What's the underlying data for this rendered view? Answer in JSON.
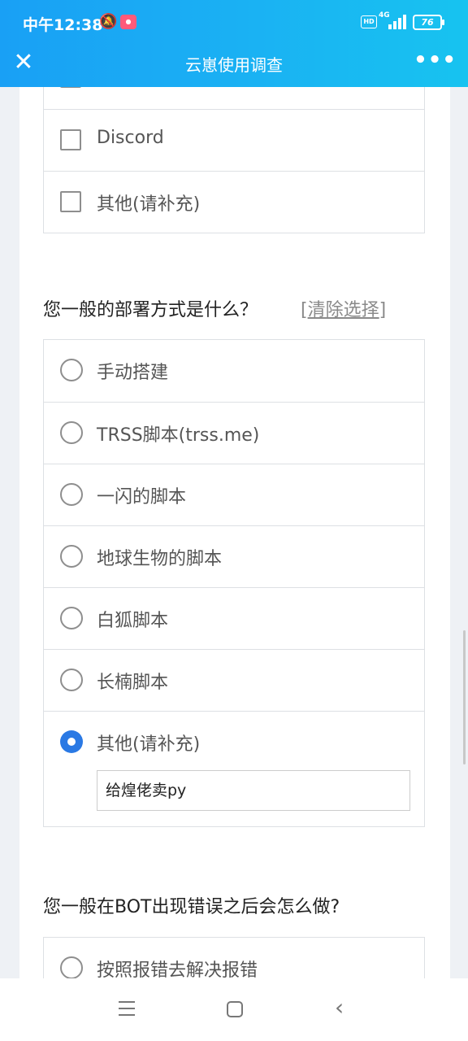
{
  "status_bar": {
    "time": "中午12:38",
    "network": "4G",
    "battery": "76",
    "hd": "HD"
  },
  "header": {
    "title": "云崽使用调查"
  },
  "q_prev": {
    "options": [
      "Discord",
      "其他(请补充)"
    ]
  },
  "q_deploy": {
    "title": "您一般的部署方式是什么？",
    "clear_label": "清除选择",
    "options": [
      "手动搭建",
      "TRSS脚本(trss.me)",
      "一闪的脚本",
      "地球生物的脚本",
      "白狐脚本",
      "长楠脚本",
      "其他(请补充)"
    ],
    "selected_index": 6,
    "other_value": "给煌佬卖py"
  },
  "q_error": {
    "title": "您一般在BOT出现错误之后会怎么做?",
    "options": [
      "按照报错去解决报错"
    ]
  },
  "colors": {
    "accent": "#2a79e4",
    "header_start": "#19a0f5",
    "header_end": "#17c3f0"
  }
}
